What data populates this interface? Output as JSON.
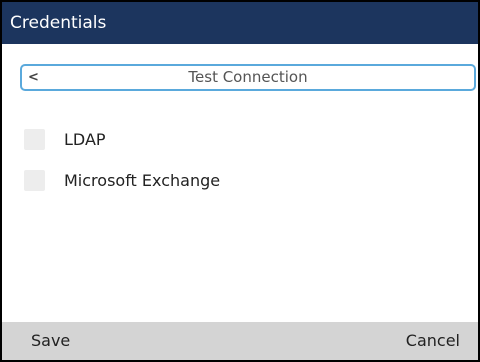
{
  "header": {
    "title": "Credentials"
  },
  "test_connection": {
    "label": "Test Connection",
    "back_icon": "chevron-left-icon"
  },
  "options": [
    {
      "label": "LDAP",
      "checked": false
    },
    {
      "label": "Microsoft Exchange",
      "checked": false
    }
  ],
  "softkeys": {
    "save": "Save",
    "cancel": "Cancel"
  },
  "colors": {
    "titlebar_bg": "#1c355e",
    "focus_border": "#5aa9dc",
    "softkey_bar_bg": "#d4d4d4",
    "checkbox_bg": "#ededed"
  }
}
